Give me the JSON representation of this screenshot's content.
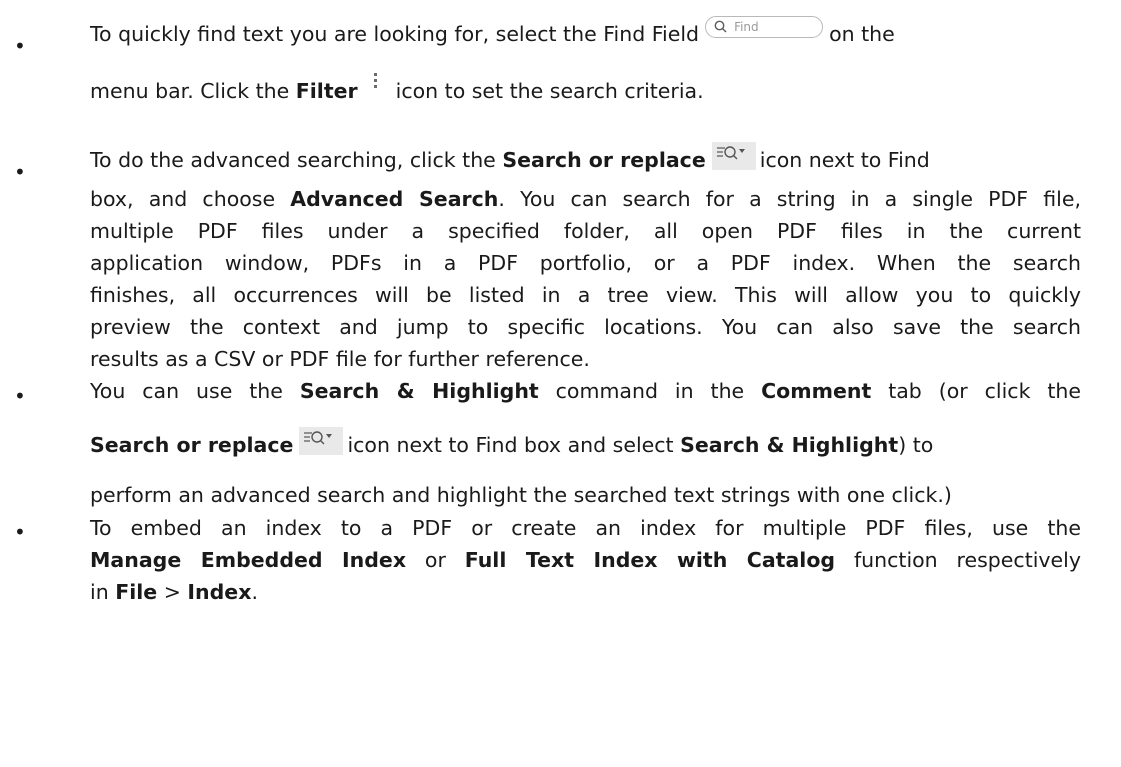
{
  "bullets": [
    {
      "l1a": "To quickly find text you are looking for, select the Find Field",
      "find_placeholder": "Find",
      "l1b": "on the",
      "l2a": "menu bar. Click the ",
      "l2b": "Filter",
      "l2c": "icon to set the search criteria."
    },
    {
      "l1a": "To do the advanced searching, click the ",
      "l1b": "Search or replace",
      "l1c": "icon next to Find",
      "l2a": "box, and choose ",
      "l2b": "Advanced Search",
      "l2c": ". You can search for a string in a single PDF file,",
      "l3": "multiple PDF files under a specified folder, all open PDF files in the current",
      "l4": "application window, PDFs in a PDF portfolio, or a PDF index. When the search",
      "l5": "finishes, all occurrences will be listed in a tree view. This will allow you to quickly",
      "l6": "preview the context and jump to specific locations. You can also save the search",
      "l7": "results as a CSV or PDF file for further reference."
    },
    {
      "l1a": "You can use the ",
      "l1b": "Search & Highlight",
      "l1c": " command in the ",
      "l1d": "Comment",
      "l1e": " tab (or click the",
      "l2a": "Search or replace",
      "l2b": "icon next to Find box and select ",
      "l2c": "Search & Highlight",
      "l2d": ") to",
      "l3": "perform an advanced search and highlight the searched text strings with one click.)"
    },
    {
      "l1": "To embed an index to a PDF or create an index for multiple PDF files, use the",
      "l2a": "Manage Embedded Index",
      "l2b": " or ",
      "l2c": "Full Text Index with Catalog",
      "l2d": " function respectively",
      "l3a": "in ",
      "l3b": "File",
      "l3c": " > ",
      "l3d": "Index",
      "l3e": "."
    }
  ]
}
